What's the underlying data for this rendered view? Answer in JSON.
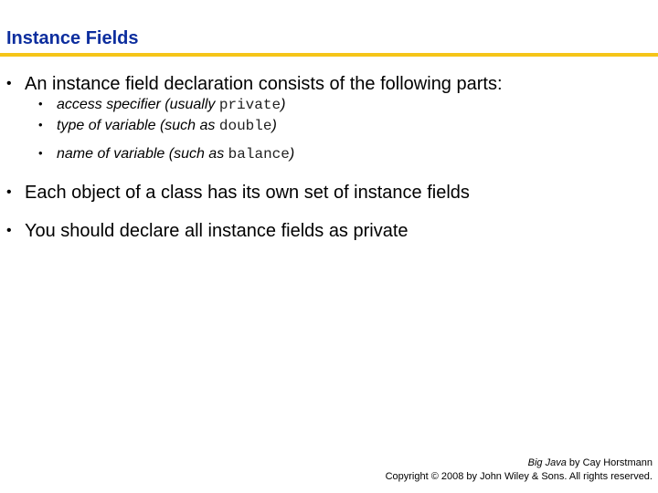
{
  "slide": {
    "title": "Instance Fields",
    "accent_color": "#f5c518",
    "title_color": "#0d2e9e",
    "bullets": [
      {
        "text": "An instance field declaration consists of the following parts:",
        "sub_bullets": [
          {
            "text": "access specifier (usually ",
            "code": "private",
            "suffix": ")"
          },
          {
            "text": "type of variable (such as ",
            "code": "double",
            "suffix": ")"
          },
          {
            "text": "name of variable (such as ",
            "code": "balance",
            "suffix": ")"
          }
        ]
      },
      {
        "text": "Each object of a class has its own set of instance fields"
      },
      {
        "text": "You should declare all instance fields as private"
      }
    ],
    "bullet_glyph": "•"
  },
  "footer": {
    "book_title": "Big Java",
    "author_line": " by Cay Horstmann",
    "copyright": "Copyright © 2008 by John Wiley & Sons.  All rights reserved."
  }
}
